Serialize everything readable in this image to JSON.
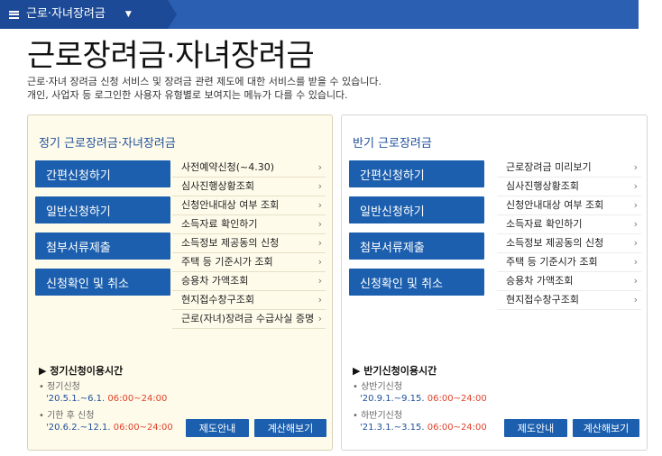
{
  "breadcrumb": {
    "label": "근로·자녀장려금"
  },
  "page": {
    "title": "근로장려금·자녀장려금",
    "desc_lines": [
      "근로·자녀 장려금 신청 서비스 및 장려금 관련 제도에 대한 서비스를 받을 수 있습니다.",
      "개인, 사업자 등 로그인한 사용자 유형별로 보여지는 메뉴가 다를 수 있습니다."
    ]
  },
  "left_panel": {
    "title": "정기 근로장려금·자녀장려금",
    "buttons": [
      "간편신청하기",
      "일반신청하기",
      "첨부서류제출",
      "신청확인 및 취소"
    ],
    "links": [
      "사전예약신청(~4.30)",
      "심사진행상황조회",
      "신청안내대상 여부 조회",
      "소득자료 확인하기",
      "소득정보 제공동의 신청",
      "주택 등 기준시가 조회",
      "승용차 가액조회",
      "현지접수창구조회",
      "근로(자녀)장려금 수급사실 증명"
    ],
    "time_head": "▶ 정기신청이용시간",
    "periods": [
      {
        "label": "정기신청",
        "date": "'20.5.1.~6.1.",
        "hours": "06:00~24:00"
      },
      {
        "label": "기한 후 신청",
        "date": "'20.6.2.~12.1.",
        "hours": "06:00~24:00"
      }
    ],
    "btn_guide": "제도안내",
    "btn_calc": "계산해보기"
  },
  "right_panel": {
    "title": "반기 근로장려금",
    "buttons": [
      "간편신청하기",
      "일반신청하기",
      "첨부서류제출",
      "신청확인 및 취소"
    ],
    "links": [
      "근로장려금 미리보기",
      "심사진행상황조회",
      "신청안내대상 여부 조회",
      "소득자료 확인하기",
      "소득정보 제공동의 신청",
      "주택 등 기준시가 조회",
      "승용차 가액조회",
      "현지접수창구조회"
    ],
    "time_head": "▶ 반기신청이용시간",
    "periods": [
      {
        "label": "상반기신청",
        "date": "'20.9.1.~9.15.",
        "hours": "06:00~24:00"
      },
      {
        "label": "하반기신청",
        "date": "'21.3.1.~3.15.",
        "hours": "06:00~24:00"
      }
    ],
    "btn_guide": "제도안내",
    "btn_calc": "계산해보기"
  },
  "colors": {
    "brand_blue": "#1c5fae",
    "top_bar": "#2b5fb1",
    "hours_red": "#e0402a",
    "panel_cream": "#fffbea"
  },
  "icons": {
    "menu": "hamburger-icon",
    "dropdown": "caret-down-icon",
    "link": "chevron-right-icon"
  }
}
